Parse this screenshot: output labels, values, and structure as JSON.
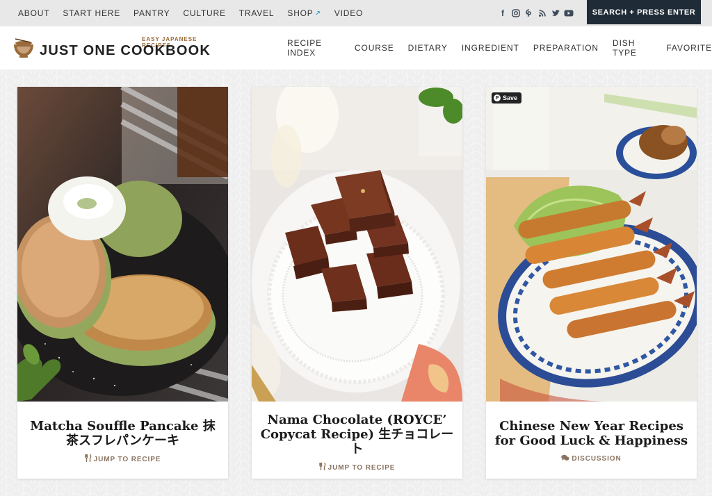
{
  "topnav": {
    "items": [
      "ABOUT",
      "START HERE",
      "PANTRY",
      "CULTURE",
      "TRAVEL",
      "SHOP",
      "VIDEO"
    ],
    "shop_external_icon": "external-link-icon"
  },
  "social": [
    "facebook-icon",
    "instagram-icon",
    "pinterest-icon",
    "rss-icon",
    "twitter-icon",
    "youtube-icon"
  ],
  "search": {
    "label": "SEARCH + PRESS ENTER"
  },
  "logo": {
    "tagline": "EASY JAPANESE RECIPES",
    "name": "JUST ONE COOKBOOK"
  },
  "mainnav": {
    "items": [
      "RECIPE INDEX",
      "COURSE",
      "DIETARY",
      "INGREDIENT",
      "PREPARATION",
      "DISH TYPE",
      "FAVORITE"
    ]
  },
  "cards": [
    {
      "title": "Matcha Souffle Pancake 抹茶スフレパンケーキ",
      "meta": "JUMP TO RECIPE",
      "meta_icon": "utensils-icon"
    },
    {
      "title": "Nama Chocolate (ROYCE’ Copycat Recipe) 生チョコレート",
      "meta": "JUMP TO RECIPE",
      "meta_icon": "utensils-icon"
    },
    {
      "title": "Chinese New Year Recipes for Good Luck & Happiness",
      "meta": "DISCUSSION",
      "meta_icon": "comments-icon"
    }
  ],
  "pin": {
    "label": "Save"
  },
  "colors": {
    "accent": "#1f2b36",
    "meta": "#8a7360",
    "external": "#1b8fc8"
  }
}
